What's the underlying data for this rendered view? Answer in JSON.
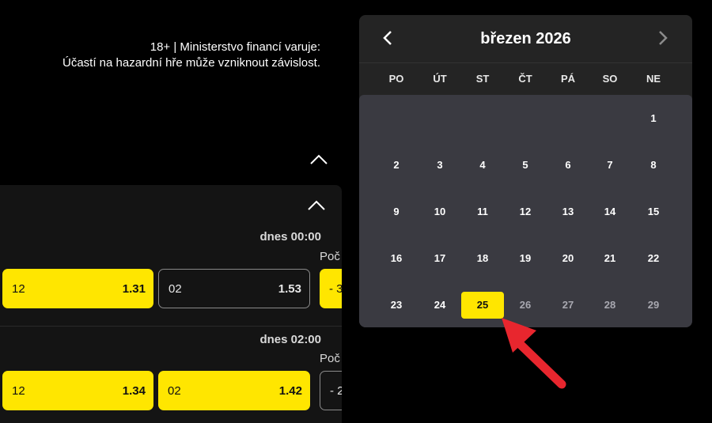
{
  "warning": {
    "line1": "18+ | Ministerstvo financí varuje:",
    "line2": "Účastí na hazardní hře může vzniknout závislost."
  },
  "matches": [
    {
      "time": "dnes 00:00",
      "count_label": "Poč",
      "odds": [
        {
          "label": "12",
          "value": "1.31",
          "style": "yellow"
        },
        {
          "label": "02",
          "value": "1.53",
          "style": "dark"
        },
        {
          "label": "- 3",
          "value": "",
          "style": "yellow"
        }
      ]
    },
    {
      "time": "dnes 02:00",
      "count_label": "Poč",
      "odds": [
        {
          "label": "12",
          "value": "1.34",
          "style": "yellow"
        },
        {
          "label": "02",
          "value": "1.42",
          "style": "yellow"
        },
        {
          "label": "- 2",
          "value": "",
          "style": "dark"
        }
      ]
    }
  ],
  "calendar": {
    "title": "březen 2026",
    "prev_icon": "chevron-left-icon",
    "next_icon": "chevron-right-icon",
    "weekdays": [
      "PO",
      "ÚT",
      "ST",
      "ČT",
      "PÁ",
      "SO",
      "NE"
    ],
    "weeks": [
      [
        "",
        "",
        "",
        "",
        "",
        "",
        "1"
      ],
      [
        "2",
        "3",
        "4",
        "5",
        "6",
        "7",
        "8"
      ],
      [
        "9",
        "10",
        "11",
        "12",
        "13",
        "14",
        "15"
      ],
      [
        "16",
        "17",
        "18",
        "19",
        "20",
        "21",
        "22"
      ],
      [
        "23",
        "24",
        "25",
        "26",
        "27",
        "28",
        "29"
      ]
    ],
    "selected_day": "25",
    "dimmed_days": [
      "26",
      "27",
      "28",
      "29"
    ]
  },
  "colors": {
    "accent_yellow": "#ffe600",
    "pointer_red": "#e8262e"
  }
}
